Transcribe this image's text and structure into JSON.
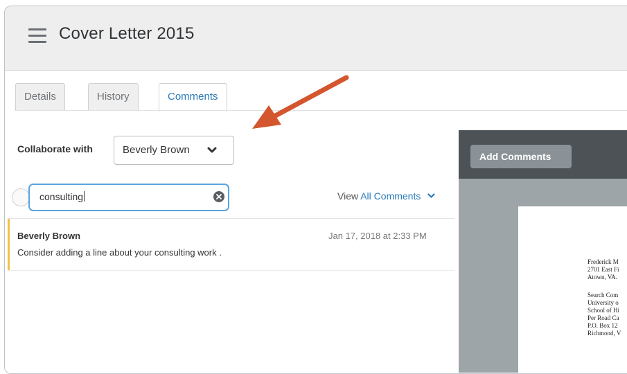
{
  "header": {
    "title": "Cover Letter 2015",
    "menu_icon": "hamburger-menu-icon"
  },
  "tabs": [
    {
      "label": "Details",
      "active": false
    },
    {
      "label": "History",
      "active": false
    },
    {
      "label": "Comments",
      "active": true
    }
  ],
  "collaborate": {
    "label": "Collaborate with",
    "selected": "Beverly Brown"
  },
  "search": {
    "value": "consulting"
  },
  "filter": {
    "prefix": "View",
    "link": "All Comments"
  },
  "comments": [
    {
      "author": "Beverly Brown",
      "date": "Jan 17, 2018 at 2:33 PM",
      "text": "Consider adding a line about your consulting work ."
    }
  ],
  "preview": {
    "add_button": "Add Comments",
    "letter_lines": [
      "Frederick M",
      "2701 East Fi",
      "Atown, VA.",
      "Search Com",
      "University o",
      "School of Hi",
      "Per Road Ca",
      "P.O. Box 12",
      "Richmond, V"
    ]
  },
  "colors": {
    "accent": "#2a7ab8",
    "comment_marker": "#f0c24a",
    "annotation_arrow": "#d3562e",
    "preview_toolbar": "#4c5256"
  }
}
